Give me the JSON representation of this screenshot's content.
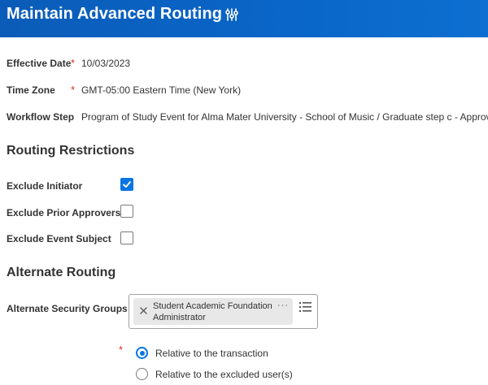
{
  "header": {
    "title": "Maintain Advanced Routing",
    "related_actions_icon": "related-actions-icon",
    "background": "#0b5cb8"
  },
  "fields": {
    "effective_date": {
      "label": "Effective Date",
      "required": "*",
      "value": "10/03/2023"
    },
    "time_zone": {
      "label": "Time Zone",
      "required": "*",
      "value": "GMT-05:00 Eastern Time (New York)"
    },
    "workflow_step": {
      "label": "Workflow Step",
      "value": "Program of Study Event for Alma Mater University - School of Music / Graduate step c - Approval"
    }
  },
  "routing_restrictions": {
    "title": "Routing Restrictions",
    "items": [
      {
        "label": "Exclude Initiator",
        "checked": true
      },
      {
        "label": "Exclude Prior Approvers",
        "checked": false
      },
      {
        "label": "Exclude Event Subject",
        "checked": false
      }
    ]
  },
  "alternate_routing": {
    "title": "Alternate Routing",
    "security_groups": {
      "label": "Alternate Security Groups",
      "selected": [
        "Student Academic Foundation Administrator"
      ],
      "more": "···",
      "prompt_icon": "list-prompt-icon"
    },
    "relative_required": "*",
    "relative_options": [
      {
        "label": "Relative to the transaction",
        "selected": true
      },
      {
        "label": "Relative to the excluded user(s)",
        "selected": false
      }
    ]
  },
  "colors": {
    "accent": "#0875e1",
    "required": "#de2d26",
    "text": "#333333"
  }
}
